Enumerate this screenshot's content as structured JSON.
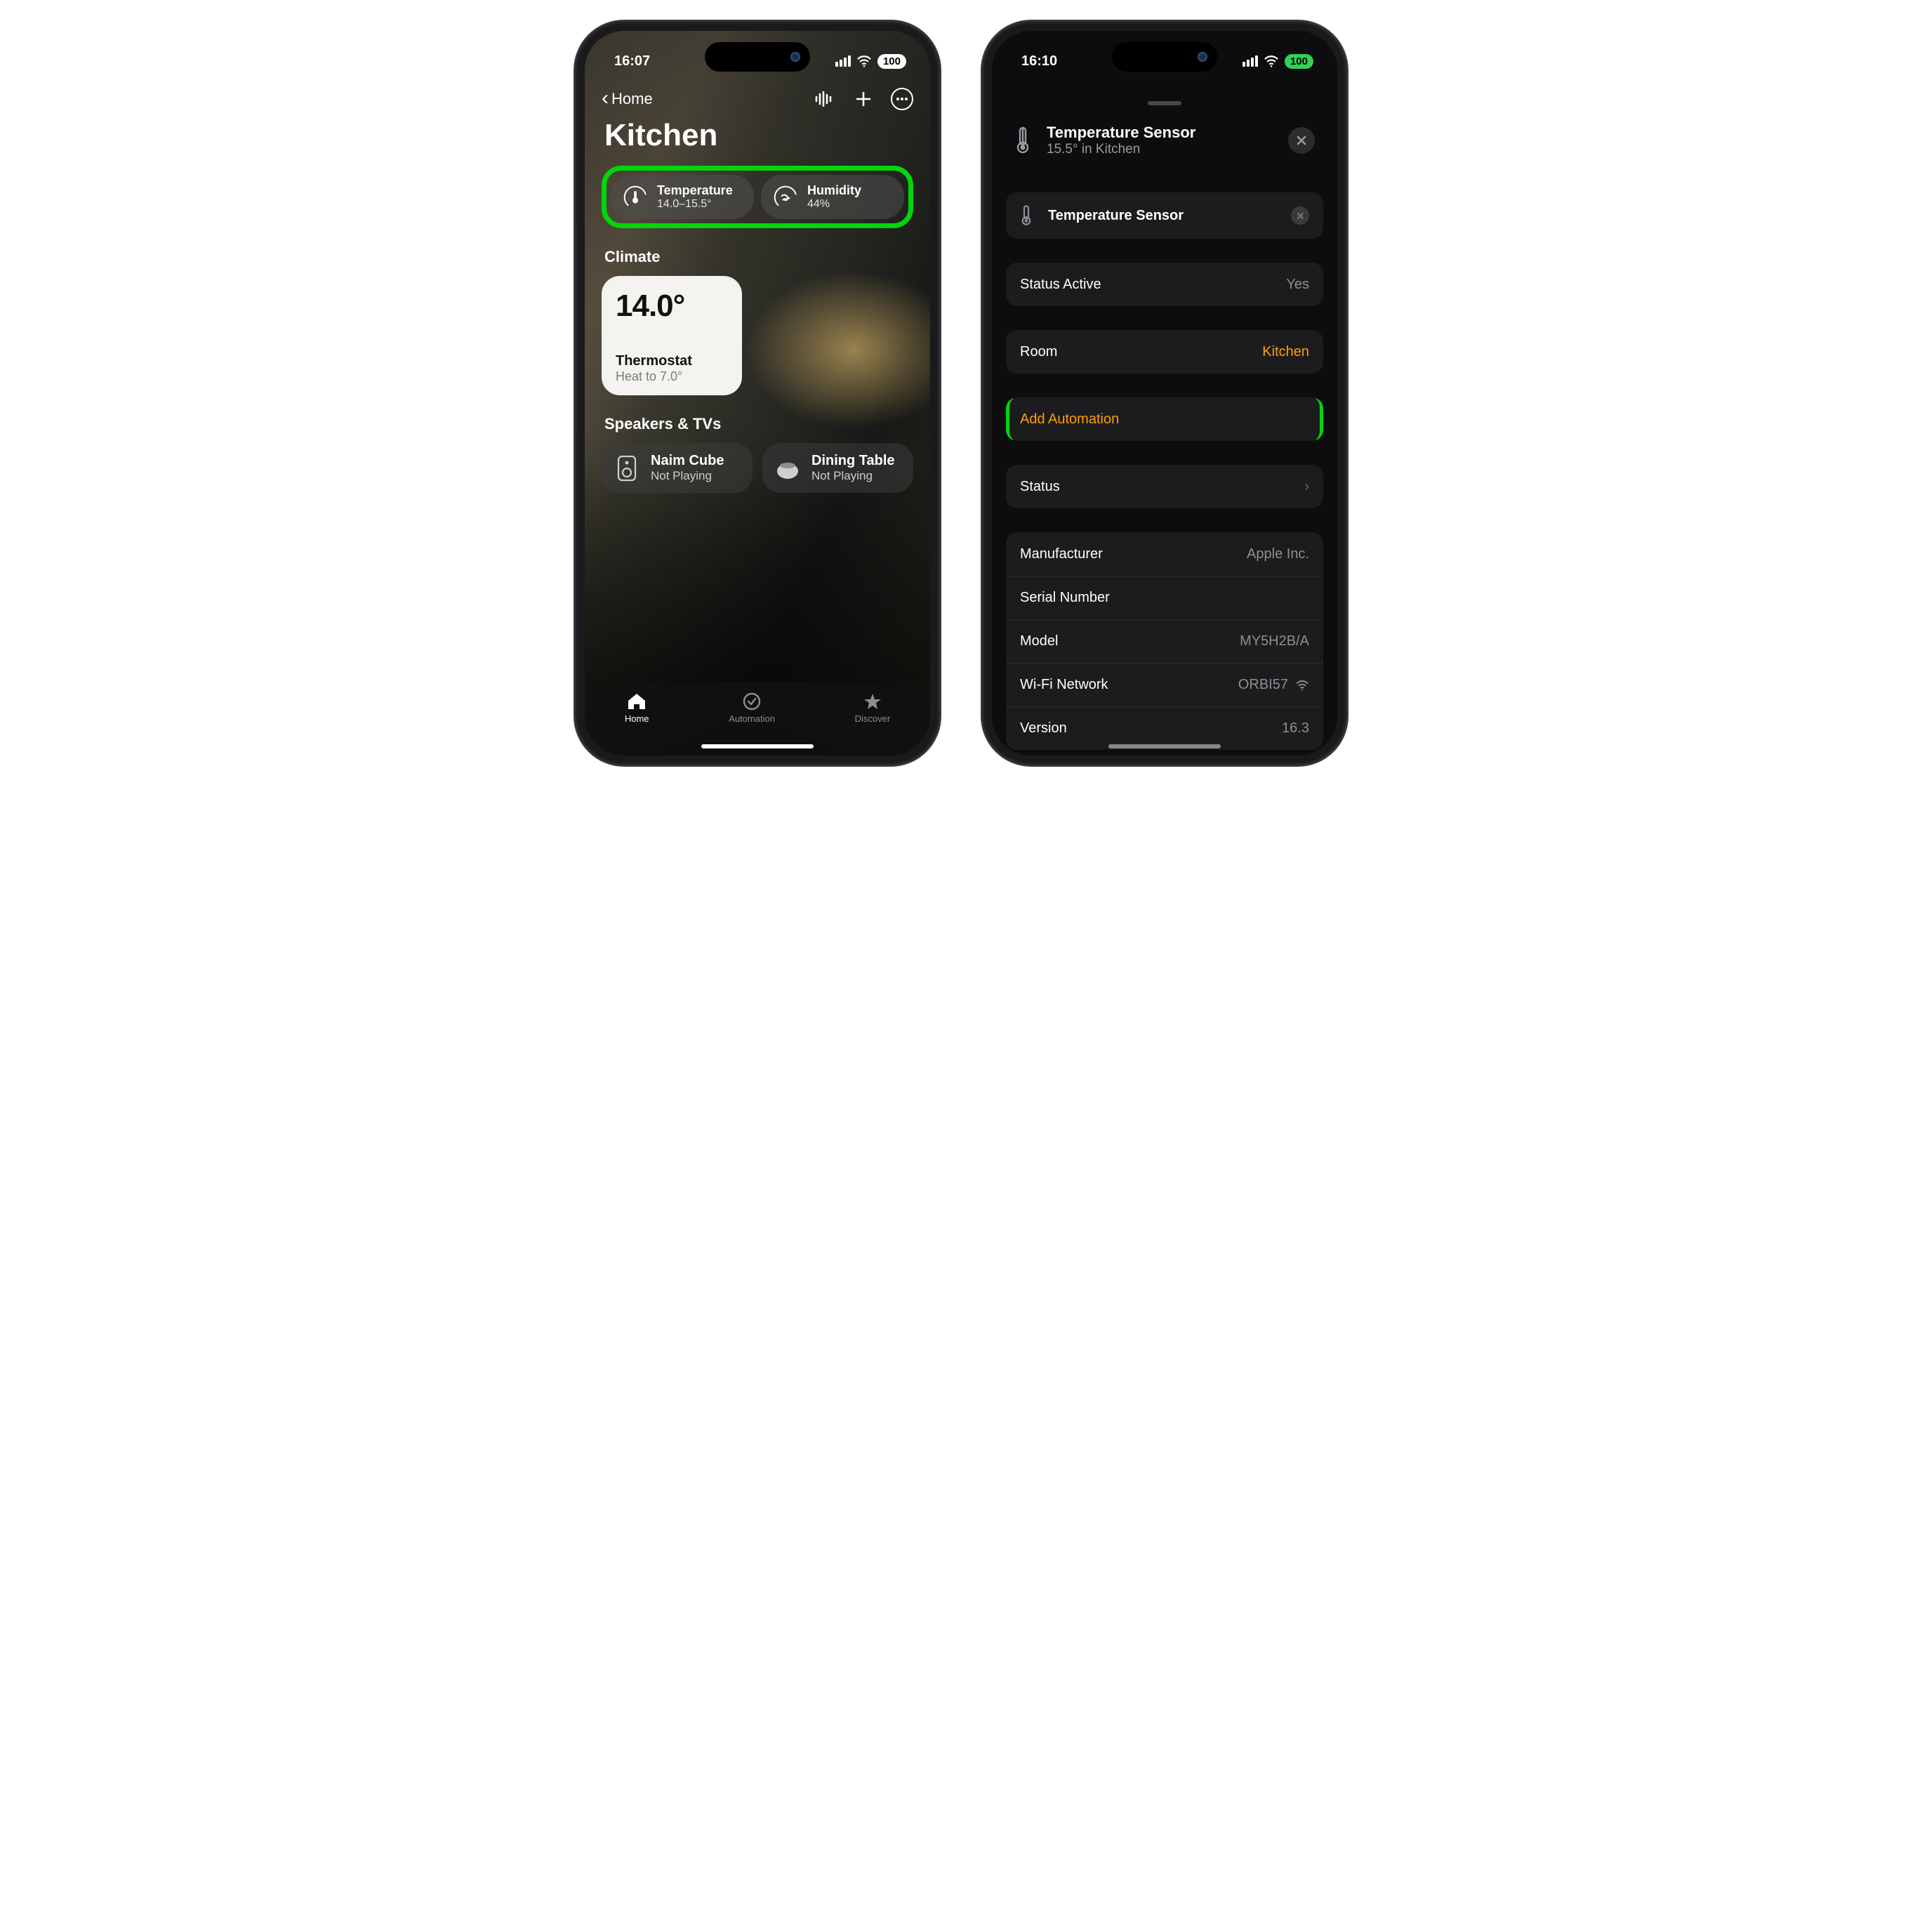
{
  "left": {
    "status": {
      "time": "16:07",
      "battery": "100"
    },
    "back_label": "Home",
    "room_title": "Kitchen",
    "temp_pill": {
      "title": "Temperature",
      "value": "14.0–15.5°"
    },
    "humidity_pill": {
      "title": "Humidity",
      "value": "44%"
    },
    "sections": {
      "climate_label": "Climate",
      "speakers_label": "Speakers & TVs"
    },
    "thermostat": {
      "reading": "14.0°",
      "name": "Thermostat",
      "status": "Heat to 7.0°"
    },
    "speakers": [
      {
        "name": "Naim Cube",
        "status": "Not Playing"
      },
      {
        "name": "Dining Table",
        "status": "Not Playing"
      }
    ],
    "tabs": {
      "home": "Home",
      "automation": "Automation",
      "discover": "Discover"
    }
  },
  "right": {
    "status": {
      "time": "16:10",
      "battery": "100"
    },
    "header": {
      "title": "Temperature Sensor",
      "subtitle": "15.5° in Kitchen"
    },
    "name_field": "Temperature Sensor",
    "rows": {
      "status_active_label": "Status Active",
      "status_active_value": "Yes",
      "room_label": "Room",
      "room_value": "Kitchen",
      "add_automation": "Add Automation",
      "status_label": "Status",
      "manufacturer_label": "Manufacturer",
      "manufacturer_value": "Apple Inc.",
      "serial_label": "Serial Number",
      "model_label": "Model",
      "model_value": "MY5H2B/A",
      "wifi_label": "Wi-Fi Network",
      "wifi_value": "ORBI57",
      "version_label": "Version",
      "version_value": "16.3"
    }
  }
}
